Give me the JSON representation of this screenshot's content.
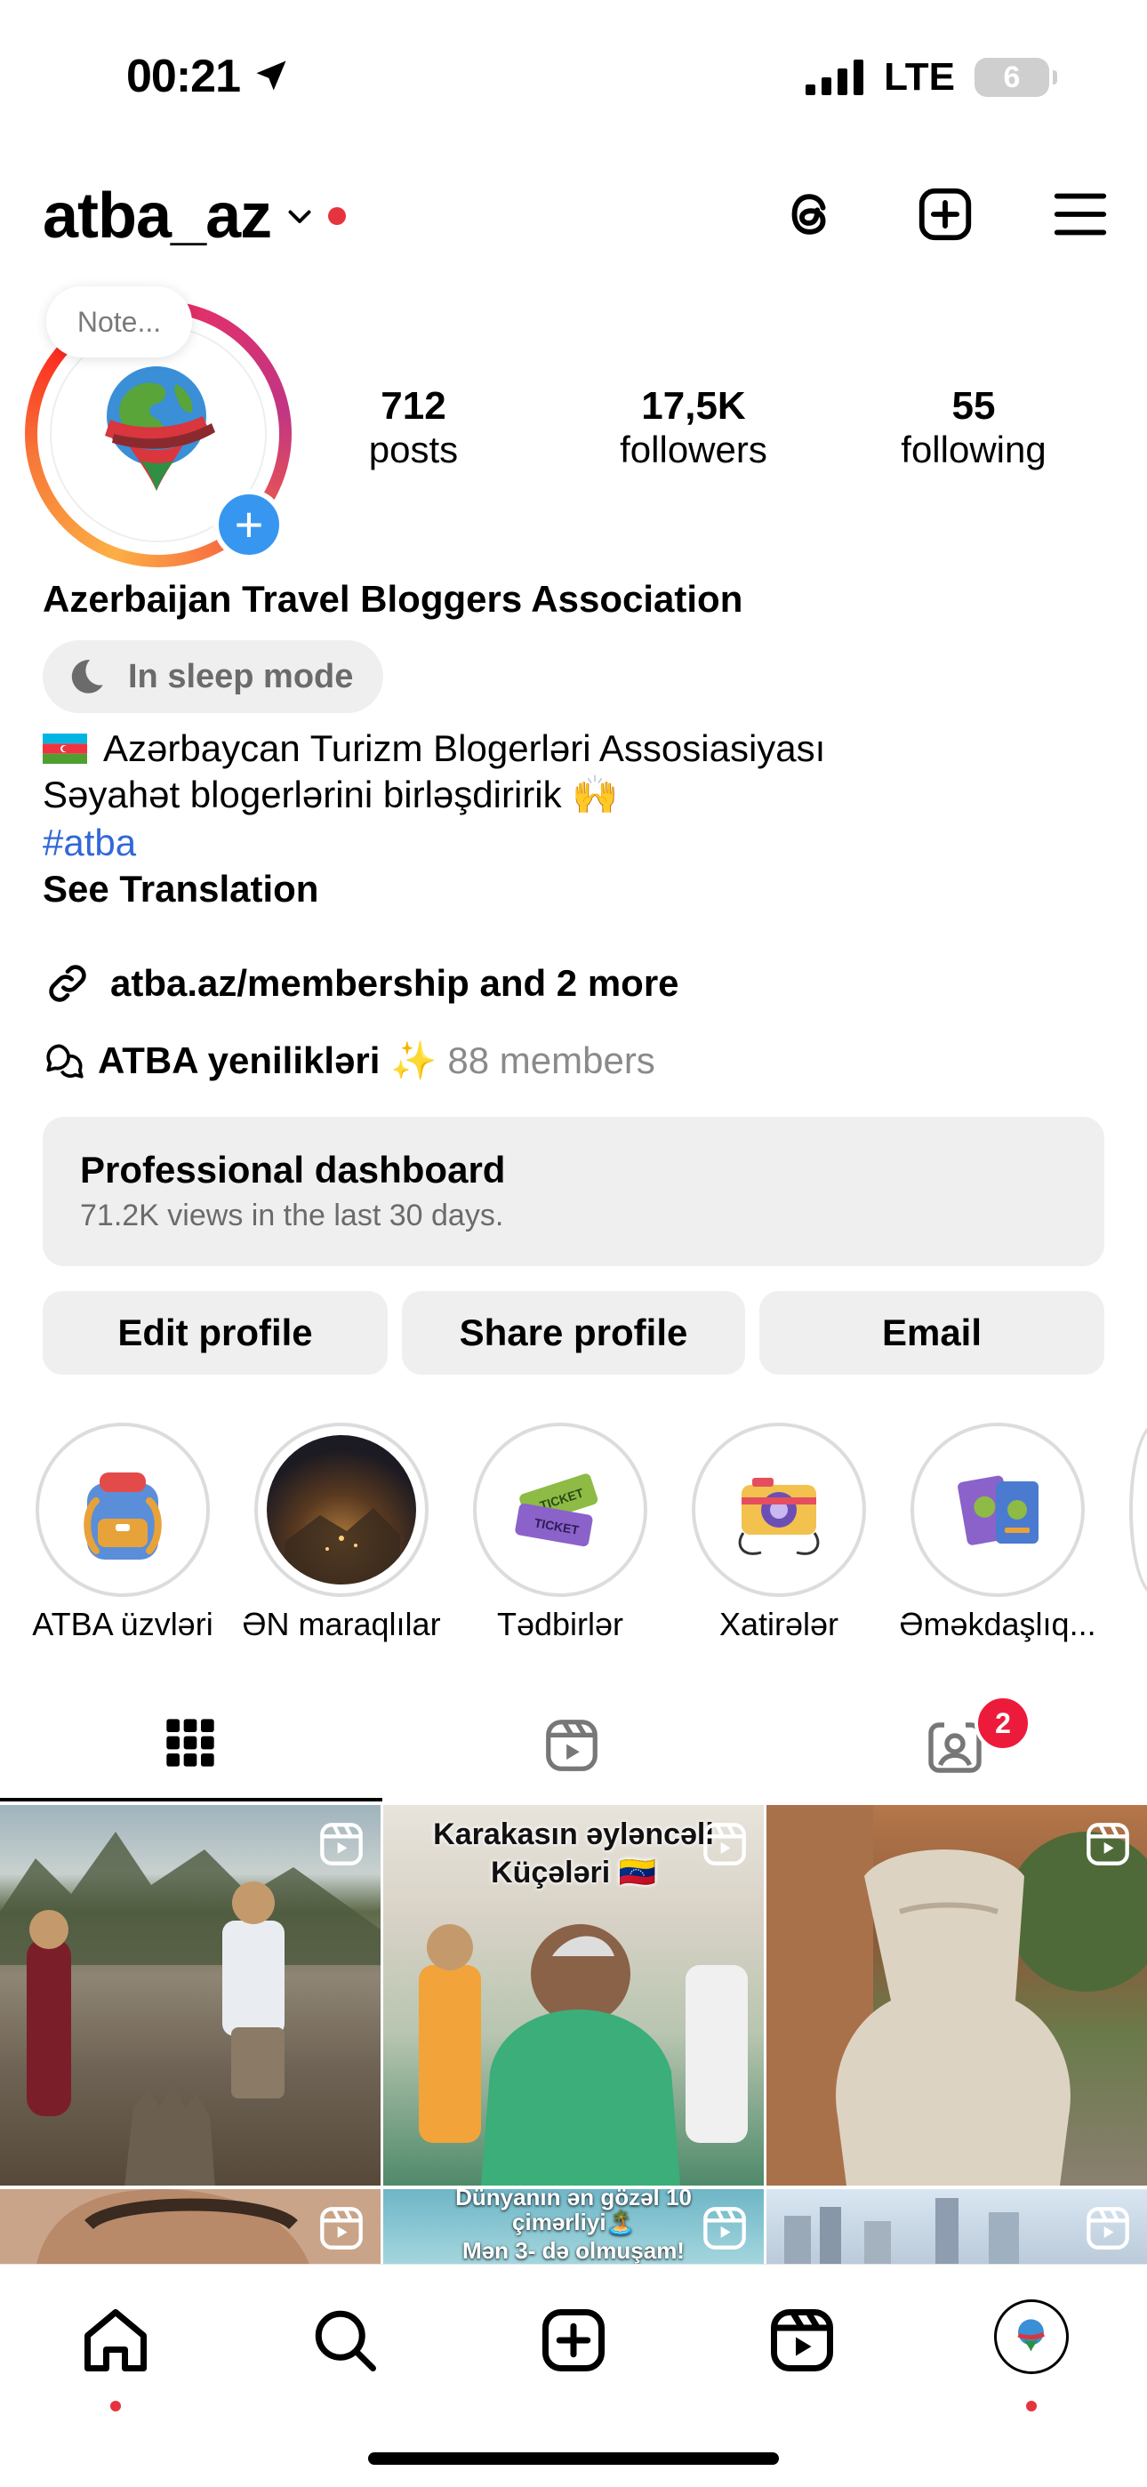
{
  "status_bar": {
    "time": "00:21",
    "network": "LTE",
    "battery": "6"
  },
  "header": {
    "username": "atba_az"
  },
  "profile": {
    "note_placeholder": "Note...",
    "stats": [
      {
        "value": "712",
        "label": "posts"
      },
      {
        "value": "17,5K",
        "label": "followers"
      },
      {
        "value": "55",
        "label": "following"
      }
    ],
    "full_name": "Azerbaijan Travel Bloggers Association",
    "sleep_mode": "In sleep mode",
    "bio_line1": "Azərbaycan Turizm Blogerləri Assosiasiyası",
    "bio_line2": "Səyahət blogerlərini birləşdiririk 🙌",
    "hashtag": "#atba",
    "see_translation": "See Translation",
    "link": "atba.az/membership and 2 more",
    "channel_name": "ATBA yenilikləri ✨",
    "channel_members": "88 members"
  },
  "dashboard": {
    "title": "Professional dashboard",
    "subtitle": "71.2K views in the last 30 days."
  },
  "buttons": {
    "edit": "Edit profile",
    "share": "Share profile",
    "email": "Email"
  },
  "highlights": [
    {
      "label": "ATBA üzvləri",
      "icon": "backpack-icon"
    },
    {
      "label": "ƏN maraqlılar",
      "icon": "city-night-photo"
    },
    {
      "label": "Tədbirlər",
      "icon": "tickets-icon"
    },
    {
      "label": "Xatirələr",
      "icon": "camera-icon"
    },
    {
      "label": "Əməkdaşlıq...",
      "icon": "passports-icon"
    }
  ],
  "tabs": {
    "tagged_badge": "2"
  },
  "grid": {
    "tile2_caption_line1": "Karakasın əyləncəli",
    "tile2_caption_line2": "Küçələri 🇻🇪",
    "tile5_caption_line1": "Dünyanın ən gözəl 10",
    "tile5_caption_line2": "çimərliyi🏝️",
    "tile5_caption_line3": "Mən 3- də olmuşam!"
  },
  "colors": {
    "accent_blue": "#3797f0",
    "notification_red": "#ed1b3b",
    "link_blue": "#3168d9"
  }
}
